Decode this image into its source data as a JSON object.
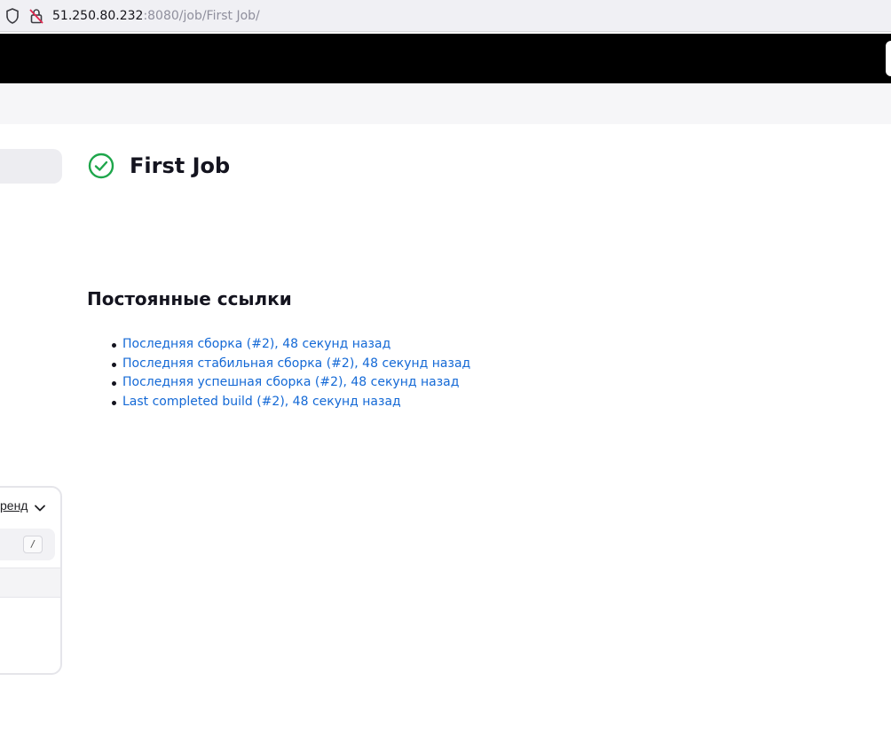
{
  "browser": {
    "url_host": "51.250.80.232",
    "url_path": ":8080/job/First Job/"
  },
  "sidebar": {
    "build_history": {
      "trend_label": "ренд",
      "search_shortcut": "/"
    }
  },
  "job": {
    "title": "First Job",
    "status": "success"
  },
  "permalinks": {
    "heading": "Постоянные ссылки",
    "items": [
      "Последняя сборка (#2), 48 секунд назад",
      "Последняя стабильная сборка (#2), 48 секунд назад",
      "Последняя успешная сборка (#2), 48 секунд назад",
      "Last completed build (#2), 48 секунд назад"
    ]
  },
  "colors": {
    "header_bg": "#000000",
    "link": "#1469d6",
    "success": "#1ea64b"
  }
}
